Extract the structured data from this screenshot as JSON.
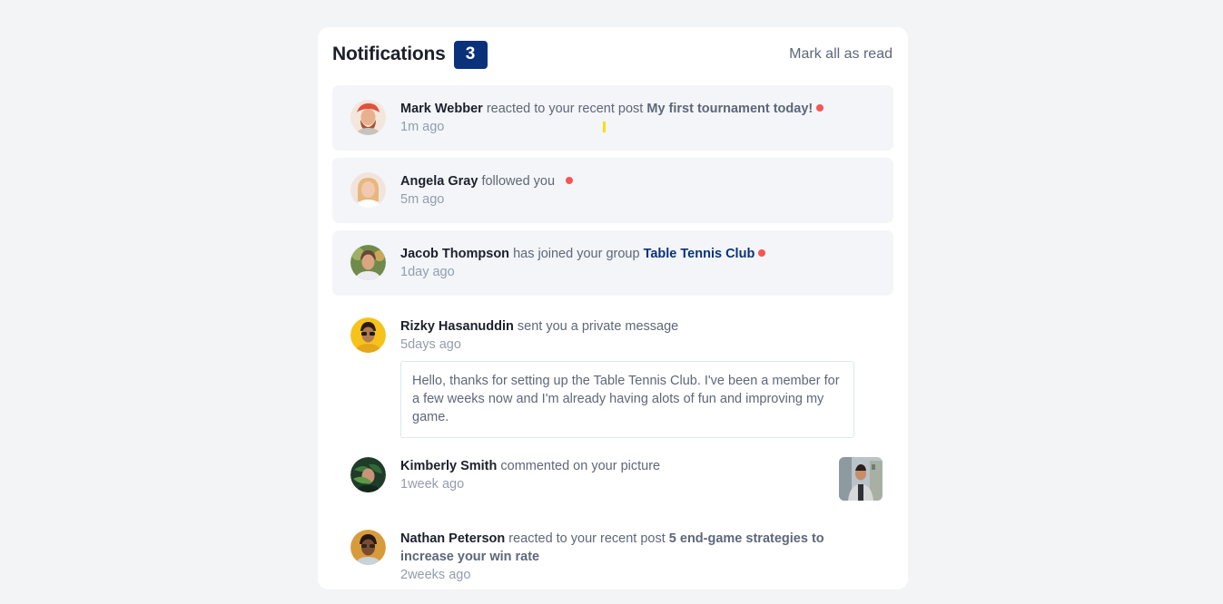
{
  "header": {
    "title": "Notifications",
    "unread_count": "3",
    "mark_all_label": "Mark all as read"
  },
  "colors": {
    "unread_bg": "#f3f5f8",
    "badge_bg": "#0a327b",
    "dot": "#f65552",
    "name": "#1c202b",
    "text": "#5e6778",
    "time": "#939dae"
  },
  "notifications": [
    {
      "name": "Mark Webber",
      "action": "reacted to your recent post",
      "target": "My first tournament today!",
      "time": "1m ago",
      "unread": true,
      "avatar": "avatar-mark-webber"
    },
    {
      "name": "Angela Gray",
      "action": "followed you",
      "time": "5m ago",
      "unread": true,
      "avatar": "avatar-angela-gray"
    },
    {
      "name": "Jacob Thompson",
      "action": "has joined your group",
      "target": "Table Tennis Club",
      "time": "1day ago",
      "unread": true,
      "avatar": "avatar-jacob-thompson"
    },
    {
      "name": "Rizky Hasanuddin",
      "action": "sent you a private message",
      "time": "5days ago",
      "message": "Hello, thanks for setting up the Table Tennis Club. I've been a member for a few weeks now and I'm already having alots of fun and improving my game.",
      "unread": false,
      "avatar": "avatar-rizky-hasanuddin"
    },
    {
      "name": "Kimberly Smith",
      "action": "commented on your picture",
      "time": "1week ago",
      "unread": false,
      "avatar": "avatar-kimberly-smith",
      "picture": "commented-picture"
    },
    {
      "name": "Nathan Peterson",
      "action": "reacted to your recent post",
      "target": "5 end-game strategies to increase your win rate",
      "time": "2weeks ago",
      "unread": false,
      "avatar": "avatar-nathan-peterson"
    }
  ]
}
